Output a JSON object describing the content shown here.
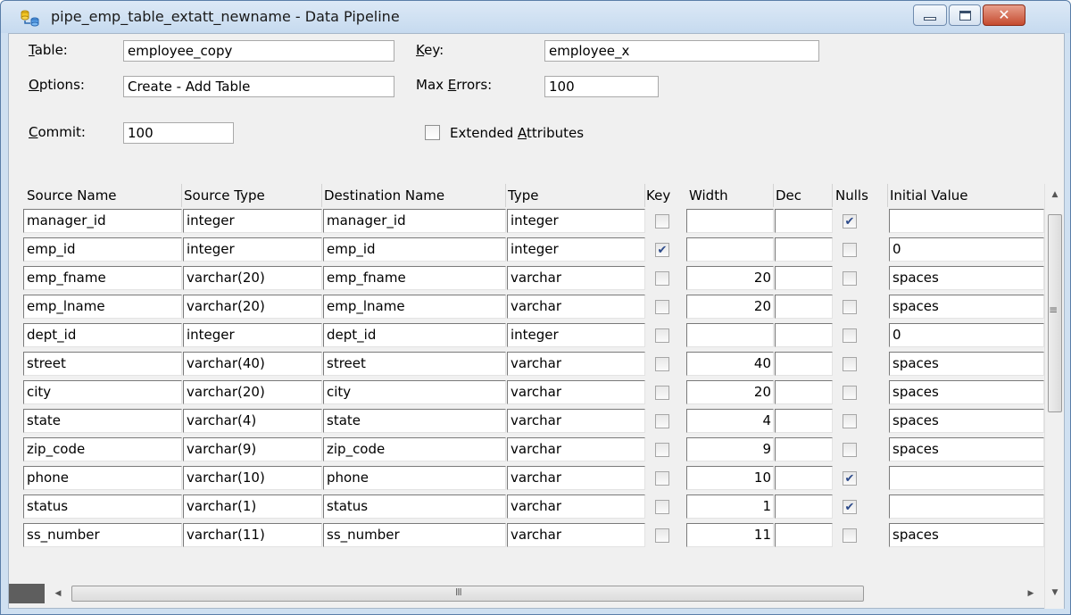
{
  "window": {
    "title": "pipe_emp_table_extatt_newname - Data Pipeline"
  },
  "form": {
    "table_label_pre": "",
    "table_label_ul": "T",
    "table_label_post": "able:",
    "table_value": "employee_copy",
    "key_label_ul": "K",
    "key_label_post": "ey:",
    "key_value": "employee_x",
    "options_label_ul": "O",
    "options_label_post": "ptions:",
    "options_value": "Create - Add Table",
    "max_errors_label_pre": "Max ",
    "max_errors_label_ul": "E",
    "max_errors_label_post": "rrors:",
    "max_errors_value": "100",
    "commit_label_ul": "C",
    "commit_label_post": "ommit:",
    "commit_value": "100",
    "extended_label_pre": "Extended ",
    "extended_label_ul": "A",
    "extended_label_post": "ttributes",
    "extended_checked": false
  },
  "grid": {
    "headers": {
      "source_name": "Source Name",
      "source_type": "Source Type",
      "destination_name": "Destination Name",
      "type": "Type",
      "key": "Key",
      "width": "Width",
      "dec": "Dec",
      "nulls": "Nulls",
      "initial_value": "Initial Value"
    },
    "rows": [
      {
        "source_name": "manager_id",
        "source_type": "integer",
        "destination_name": "manager_id",
        "type": "integer",
        "key": false,
        "width": "",
        "dec": "",
        "nulls": true,
        "initial_value": ""
      },
      {
        "source_name": "emp_id",
        "source_type": "integer",
        "destination_name": "emp_id",
        "type": "integer",
        "key": true,
        "width": "",
        "dec": "",
        "nulls": false,
        "initial_value": "0"
      },
      {
        "source_name": "emp_fname",
        "source_type": "varchar(20)",
        "destination_name": "emp_fname",
        "type": "varchar",
        "key": false,
        "width": "20",
        "dec": "",
        "nulls": false,
        "initial_value": "spaces"
      },
      {
        "source_name": "emp_lname",
        "source_type": "varchar(20)",
        "destination_name": "emp_lname",
        "type": "varchar",
        "key": false,
        "width": "20",
        "dec": "",
        "nulls": false,
        "initial_value": "spaces"
      },
      {
        "source_name": "dept_id",
        "source_type": "integer",
        "destination_name": "dept_id",
        "type": "integer",
        "key": false,
        "width": "",
        "dec": "",
        "nulls": false,
        "initial_value": "0"
      },
      {
        "source_name": "street",
        "source_type": "varchar(40)",
        "destination_name": "street",
        "type": "varchar",
        "key": false,
        "width": "40",
        "dec": "",
        "nulls": false,
        "initial_value": "spaces"
      },
      {
        "source_name": "city",
        "source_type": "varchar(20)",
        "destination_name": "city",
        "type": "varchar",
        "key": false,
        "width": "20",
        "dec": "",
        "nulls": false,
        "initial_value": "spaces"
      },
      {
        "source_name": "state",
        "source_type": "varchar(4)",
        "destination_name": "state",
        "type": "varchar",
        "key": false,
        "width": "4",
        "dec": "",
        "nulls": false,
        "initial_value": "spaces"
      },
      {
        "source_name": "zip_code",
        "source_type": "varchar(9)",
        "destination_name": "zip_code",
        "type": "varchar",
        "key": false,
        "width": "9",
        "dec": "",
        "nulls": false,
        "initial_value": "spaces"
      },
      {
        "source_name": "phone",
        "source_type": "varchar(10)",
        "destination_name": "phone",
        "type": "varchar",
        "key": false,
        "width": "10",
        "dec": "",
        "nulls": true,
        "initial_value": ""
      },
      {
        "source_name": "status",
        "source_type": "varchar(1)",
        "destination_name": "status",
        "type": "varchar",
        "key": false,
        "width": "1",
        "dec": "",
        "nulls": true,
        "initial_value": ""
      },
      {
        "source_name": "ss_number",
        "source_type": "varchar(11)",
        "destination_name": "ss_number",
        "type": "varchar",
        "key": false,
        "width": "11",
        "dec": "",
        "nulls": false,
        "initial_value": "spaces"
      }
    ]
  },
  "scrollbars": {
    "horizontal_grip": "III"
  }
}
